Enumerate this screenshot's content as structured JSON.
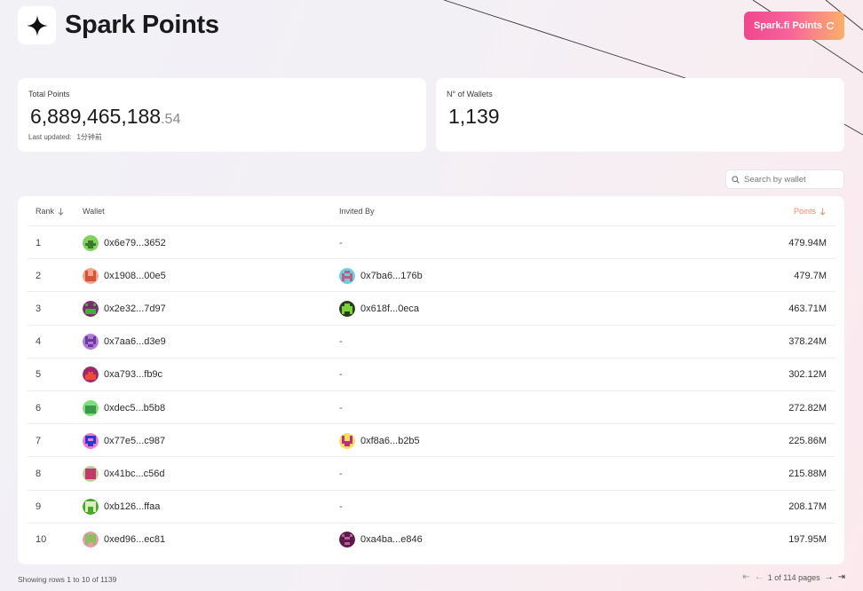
{
  "header": {
    "title": "Spark Points",
    "logo_icon": "four-point-star-icon",
    "cta_label": "Spark.fi Points",
    "cta_icon": "refresh-icon"
  },
  "stats": {
    "total_label": "Total Points",
    "total_value": "6,889,465,188",
    "total_decimal": ".54",
    "last_updated_label": "Last updated:",
    "last_updated_value": "1分钟前",
    "wallets_label": "N° of Wallets",
    "wallets_value": "1,139"
  },
  "search": {
    "placeholder": "Search by wallet",
    "icon": "search-icon"
  },
  "table": {
    "columns": {
      "rank": "Rank",
      "wallet": "Wallet",
      "invited_by": "Invited By",
      "points": "Points"
    },
    "rows": [
      {
        "rank": "1",
        "wallet": "0x6e79...3652",
        "invited": "-",
        "points": "479.94M"
      },
      {
        "rank": "2",
        "wallet": "0x1908...00e5",
        "invited": "0x7ba6...176b",
        "points": "479.7M"
      },
      {
        "rank": "3",
        "wallet": "0x2e32...7d97",
        "invited": "0x618f...0eca",
        "points": "463.71M"
      },
      {
        "rank": "4",
        "wallet": "0x7aa6...d3e9",
        "invited": "-",
        "points": "378.24M"
      },
      {
        "rank": "5",
        "wallet": "0xa793...fb9c",
        "invited": "-",
        "points": "302.12M"
      },
      {
        "rank": "6",
        "wallet": "0xdec5...b5b8",
        "invited": "-",
        "points": "272.82M"
      },
      {
        "rank": "7",
        "wallet": "0x77e5...c987",
        "invited": "0xf8a6...b2b5",
        "points": "225.86M"
      },
      {
        "rank": "8",
        "wallet": "0x41bc...c56d",
        "invited": "-",
        "points": "215.88M"
      },
      {
        "rank": "9",
        "wallet": "0xb126...ffaa",
        "invited": "-",
        "points": "208.17M"
      },
      {
        "rank": "10",
        "wallet": "0xed96...ec81",
        "invited": "0xa4ba...e846",
        "points": "197.95M"
      }
    ]
  },
  "footer": {
    "showing": "Showing rows 1 to 10 of 1139",
    "page_info": "1 of 114 pages"
  },
  "colors": {
    "accent_pink": "#f0468d",
    "accent_orange": "#fbb06a",
    "points_header": "#f08a64"
  },
  "avatars": {
    "wallets": [
      {
        "bg": "#7fd25a",
        "fg": "#3a7a2a"
      },
      {
        "bg": "#f4a38a",
        "fg": "#d2553a"
      },
      {
        "bg": "#7a2c6e",
        "fg": "#3fb03a"
      },
      {
        "bg": "#b07ad8",
        "fg": "#6a3a9a"
      },
      {
        "bg": "#9a2a6a",
        "fg": "#f04a3a"
      },
      {
        "bg": "#7ee07a",
        "fg": "#3a9a4a"
      },
      {
        "bg": "#f07ac8",
        "fg": "#2a3ad0"
      },
      {
        "bg": "#b8d29a",
        "fg": "#c03a6a"
      },
      {
        "bg": "#4aa82a",
        "fg": "#d8f0c0"
      },
      {
        "bg": "#e89aa8",
        "fg": "#8ac060"
      }
    ],
    "invited": [
      null,
      {
        "bg": "#6ad0d8",
        "fg": "#c05a8a"
      },
      {
        "bg": "#2a3a1a",
        "fg": "#7ad23a"
      },
      null,
      null,
      null,
      {
        "bg": "#f0e05a",
        "fg": "#c02a8a"
      },
      null,
      null,
      {
        "bg": "#5a1a4a",
        "fg": "#c05a9a"
      }
    ]
  }
}
